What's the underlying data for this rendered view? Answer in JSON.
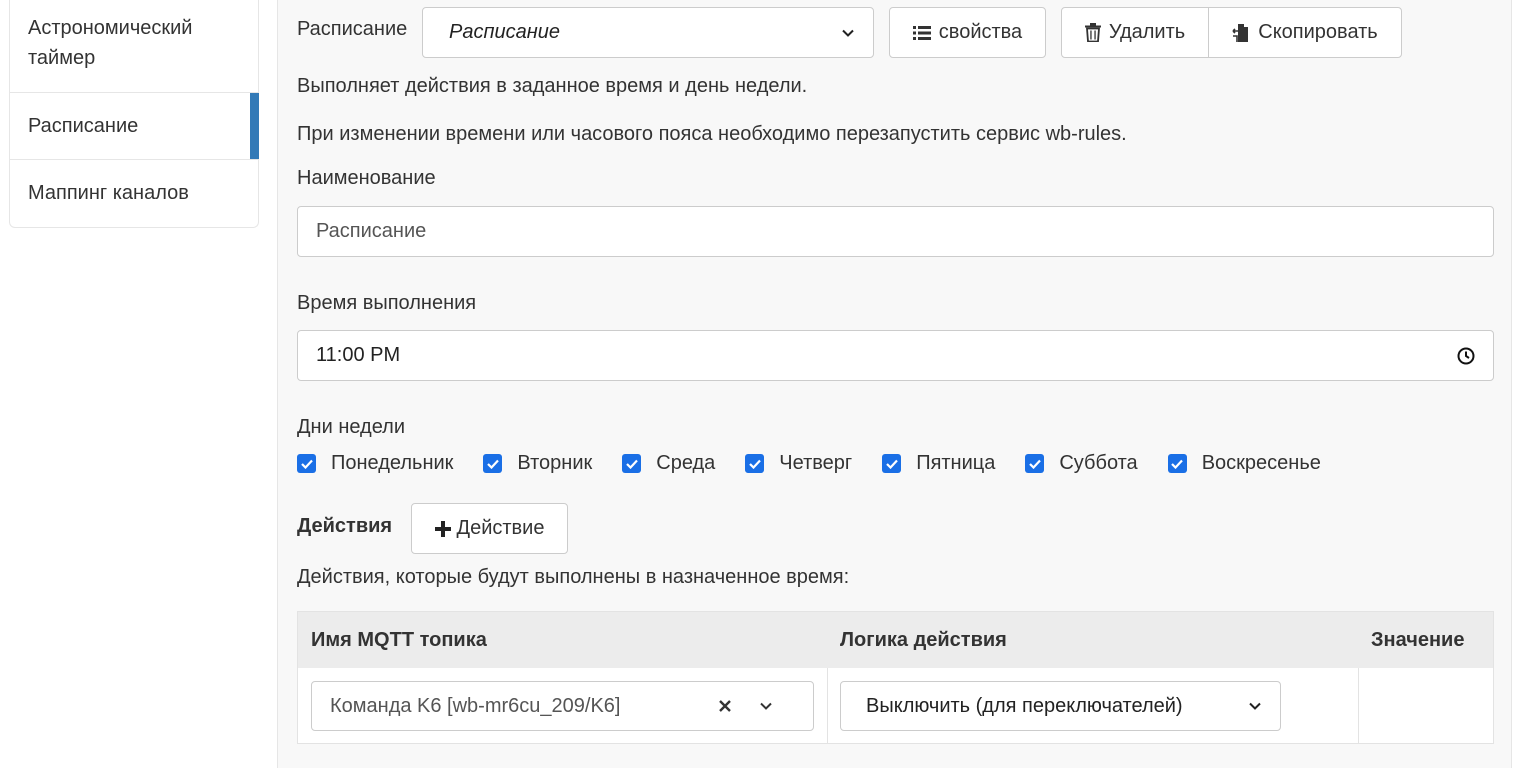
{
  "sidebar": {
    "items": [
      {
        "label": "Астрономический таймер"
      },
      {
        "label": "Расписание"
      },
      {
        "label": "Маппинг каналов"
      }
    ]
  },
  "header": {
    "rule_type_label": "Расписание",
    "rule_type_value": "Расписание",
    "properties_button": "свойства",
    "delete_button": "Удалить",
    "copy_button": "Скопировать"
  },
  "description": {
    "line1": "Выполняет действия в заданное время и день недели.",
    "line2": "При изменении времени или часового пояса необходимо перезапустить сервис wb-rules."
  },
  "name_field": {
    "label": "Наименование",
    "value": "Расписание"
  },
  "time_field": {
    "label": "Время выполнения",
    "value": "11:00 PM"
  },
  "weekdays": {
    "label": "Дни недели",
    "items": [
      {
        "label": "Понедельник",
        "checked": true
      },
      {
        "label": "Вторник",
        "checked": true
      },
      {
        "label": "Среда",
        "checked": true
      },
      {
        "label": "Четверг",
        "checked": true
      },
      {
        "label": "Пятница",
        "checked": true
      },
      {
        "label": "Суббота",
        "checked": true
      },
      {
        "label": "Воскресенье",
        "checked": true
      }
    ]
  },
  "actions": {
    "heading": "Действия",
    "add_button": "Действие",
    "hint": "Действия, которые будут выполнены в назначенное время:",
    "columns": [
      "Имя MQTT топика",
      "Логика действия",
      "Значение"
    ],
    "rows": [
      {
        "topic": "Команда K6 [wb-mr6cu_209/K6]",
        "logic": "Выключить (для переключателей)",
        "value": ""
      }
    ]
  },
  "colors": {
    "accent": "#337ab7",
    "checkbox": "#1a6fe6"
  }
}
